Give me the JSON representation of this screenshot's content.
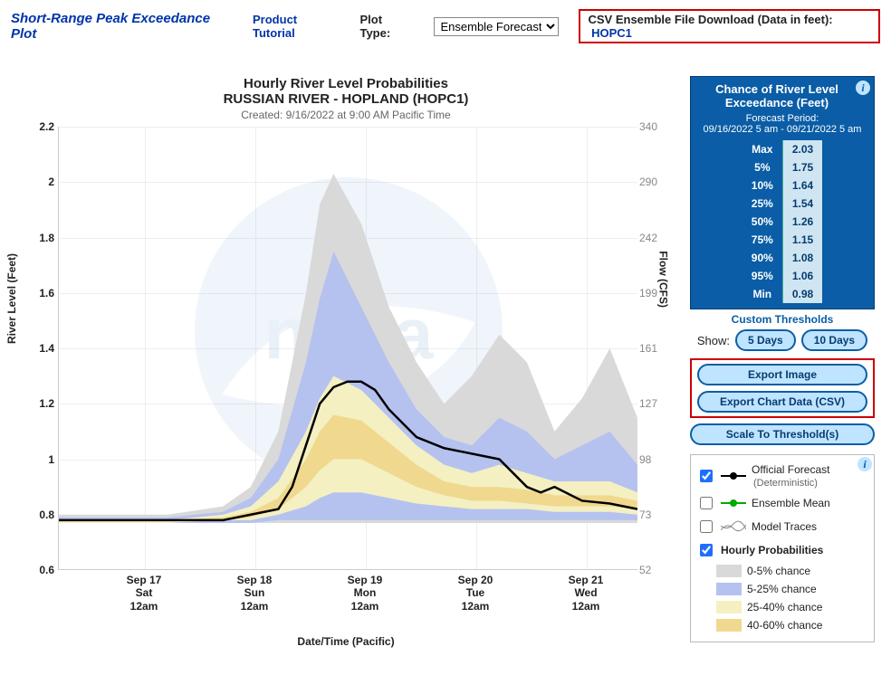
{
  "topbar": {
    "title": "Short-Range Peak Exceedance Plot",
    "tutorial": "Product Tutorial",
    "plot_type_label": "Plot Type:",
    "plot_type_value": "Ensemble Forecast",
    "csv_label": "CSV Ensemble File Download (Data in feet):",
    "csv_link": "HOPC1"
  },
  "chart_meta": {
    "title1": "Hourly River Level Probabilities",
    "title2": "RUSSIAN RIVER - HOPLAND (HOPC1)",
    "created": "Created: 9/16/2022 at 9:00 AM Pacific Time",
    "ylabel_left": "River Level (Feet)",
    "ylabel_right": "Flow (CFS)",
    "xlabel": "Date/Time (Pacific)"
  },
  "chart_data": {
    "type": "area",
    "x_ticks": [
      "Sep 17\nSat\n12am",
      "Sep 18\nSun\n12am",
      "Sep 19\nMon\n12am",
      "Sep 20\nTue\n12am",
      "Sep 21\nWed\n12am"
    ],
    "y_left_ticks": [
      0.6,
      0.8,
      1.0,
      1.2,
      1.4,
      1.6,
      1.8,
      2.0,
      2.2
    ],
    "y_right_ticks": [
      52,
      73,
      98,
      127,
      161,
      199,
      242,
      290,
      340
    ],
    "ylim_left": [
      0.6,
      2.2
    ],
    "series_forecast": {
      "name": "Official Forecast (Deterministic)",
      "color": "#000000",
      "x_hours": [
        0,
        6,
        12,
        18,
        24,
        30,
        36,
        42,
        48,
        51,
        54,
        57,
        60,
        63,
        66,
        69,
        72,
        78,
        84,
        90,
        96,
        99,
        102,
        105,
        108,
        114,
        120,
        126
      ],
      "y_feet": [
        0.78,
        0.78,
        0.78,
        0.78,
        0.78,
        0.78,
        0.78,
        0.8,
        0.82,
        0.9,
        1.05,
        1.2,
        1.26,
        1.28,
        1.28,
        1.25,
        1.18,
        1.08,
        1.04,
        1.02,
        1.0,
        0.95,
        0.9,
        0.88,
        0.9,
        0.85,
        0.84,
        0.82
      ]
    },
    "probability_bands": [
      {
        "name": "0-5% chance",
        "color": "#d9d9d9",
        "x_hours": [
          0,
          24,
          36,
          42,
          48,
          54,
          57,
          60,
          66,
          72,
          78,
          84,
          90,
          96,
          102,
          108,
          114,
          120,
          126
        ],
        "upper": [
          0.8,
          0.8,
          0.83,
          0.9,
          1.1,
          1.6,
          1.92,
          2.03,
          1.85,
          1.55,
          1.35,
          1.2,
          1.3,
          1.45,
          1.35,
          1.1,
          1.22,
          1.4,
          1.15
        ],
        "lower": [
          0.77,
          0.77,
          0.77,
          0.77,
          0.77,
          0.77,
          0.77,
          0.77,
          0.77,
          0.77,
          0.77,
          0.77,
          0.77,
          0.77,
          0.77,
          0.77,
          0.77,
          0.77,
          0.77
        ]
      },
      {
        "name": "5-25% chance",
        "color": "#b5c2f0",
        "x_hours": [
          0,
          24,
          36,
          42,
          48,
          54,
          57,
          60,
          66,
          72,
          78,
          84,
          90,
          96,
          102,
          108,
          114,
          120,
          126
        ],
        "upper": [
          0.79,
          0.79,
          0.81,
          0.86,
          1.0,
          1.35,
          1.58,
          1.75,
          1.55,
          1.35,
          1.18,
          1.08,
          1.05,
          1.15,
          1.1,
          1.0,
          1.05,
          1.1,
          0.98
        ],
        "lower": [
          0.77,
          0.77,
          0.77,
          0.77,
          0.78,
          0.78,
          0.78,
          0.78,
          0.78,
          0.78,
          0.78,
          0.78,
          0.78,
          0.78,
          0.78,
          0.78,
          0.78,
          0.78,
          0.78
        ]
      },
      {
        "name": "25-40% chance",
        "color": "#f4f0c2",
        "x_hours": [
          0,
          24,
          36,
          42,
          48,
          54,
          57,
          60,
          66,
          72,
          78,
          84,
          90,
          96,
          102,
          108,
          114,
          120,
          126
        ],
        "upper": [
          0.78,
          0.78,
          0.8,
          0.83,
          0.92,
          1.1,
          1.22,
          1.3,
          1.25,
          1.15,
          1.05,
          0.98,
          0.95,
          0.98,
          0.95,
          0.92,
          0.92,
          0.92,
          0.88
        ],
        "lower": [
          0.77,
          0.77,
          0.78,
          0.78,
          0.8,
          0.83,
          0.86,
          0.88,
          0.88,
          0.86,
          0.84,
          0.83,
          0.82,
          0.82,
          0.82,
          0.81,
          0.81,
          0.81,
          0.8
        ]
      },
      {
        "name": "40-60% chance",
        "color": "#f0d98e",
        "x_hours": [
          0,
          24,
          36,
          42,
          48,
          54,
          57,
          60,
          66,
          72,
          78,
          84,
          90,
          96,
          102,
          108,
          114,
          120,
          126
        ],
        "upper": [
          0.78,
          0.78,
          0.79,
          0.81,
          0.86,
          1.0,
          1.1,
          1.16,
          1.14,
          1.06,
          0.98,
          0.92,
          0.9,
          0.9,
          0.89,
          0.87,
          0.87,
          0.87,
          0.85
        ],
        "lower": [
          0.78,
          0.78,
          0.78,
          0.79,
          0.82,
          0.9,
          0.96,
          1.0,
          1.0,
          0.95,
          0.9,
          0.87,
          0.85,
          0.85,
          0.84,
          0.83,
          0.83,
          0.83,
          0.82
        ]
      }
    ]
  },
  "exceed": {
    "header1": "Chance of River Level",
    "header2": "Exceedance (Feet)",
    "period_label": "Forecast Period:",
    "period": "09/16/2022 5 am - 09/21/2022 5 am",
    "rows": [
      {
        "label": "Max",
        "value": "2.03"
      },
      {
        "label": "5%",
        "value": "1.75"
      },
      {
        "label": "10%",
        "value": "1.64"
      },
      {
        "label": "25%",
        "value": "1.54"
      },
      {
        "label": "50%",
        "value": "1.26"
      },
      {
        "label": "75%",
        "value": "1.15"
      },
      {
        "label": "90%",
        "value": "1.08"
      },
      {
        "label": "95%",
        "value": "1.06"
      },
      {
        "label": "Min",
        "value": "0.98"
      }
    ],
    "custom": "Custom Thresholds"
  },
  "controls": {
    "show_label": "Show:",
    "days5": "5 Days",
    "days10": "10 Days",
    "export_image": "Export Image",
    "export_csv": "Export Chart Data (CSV)",
    "scale": "Scale To Threshold(s)"
  },
  "legend": {
    "official": "Official Forecast",
    "official_sub": "(Deterministic)",
    "ensemble": "Ensemble Mean",
    "traces": "Model Traces",
    "hourly": "Hourly Probabilities",
    "b1": "0-5% chance",
    "b2": "5-25% chance",
    "b3": "25-40% chance",
    "b4": "40-60% chance"
  }
}
